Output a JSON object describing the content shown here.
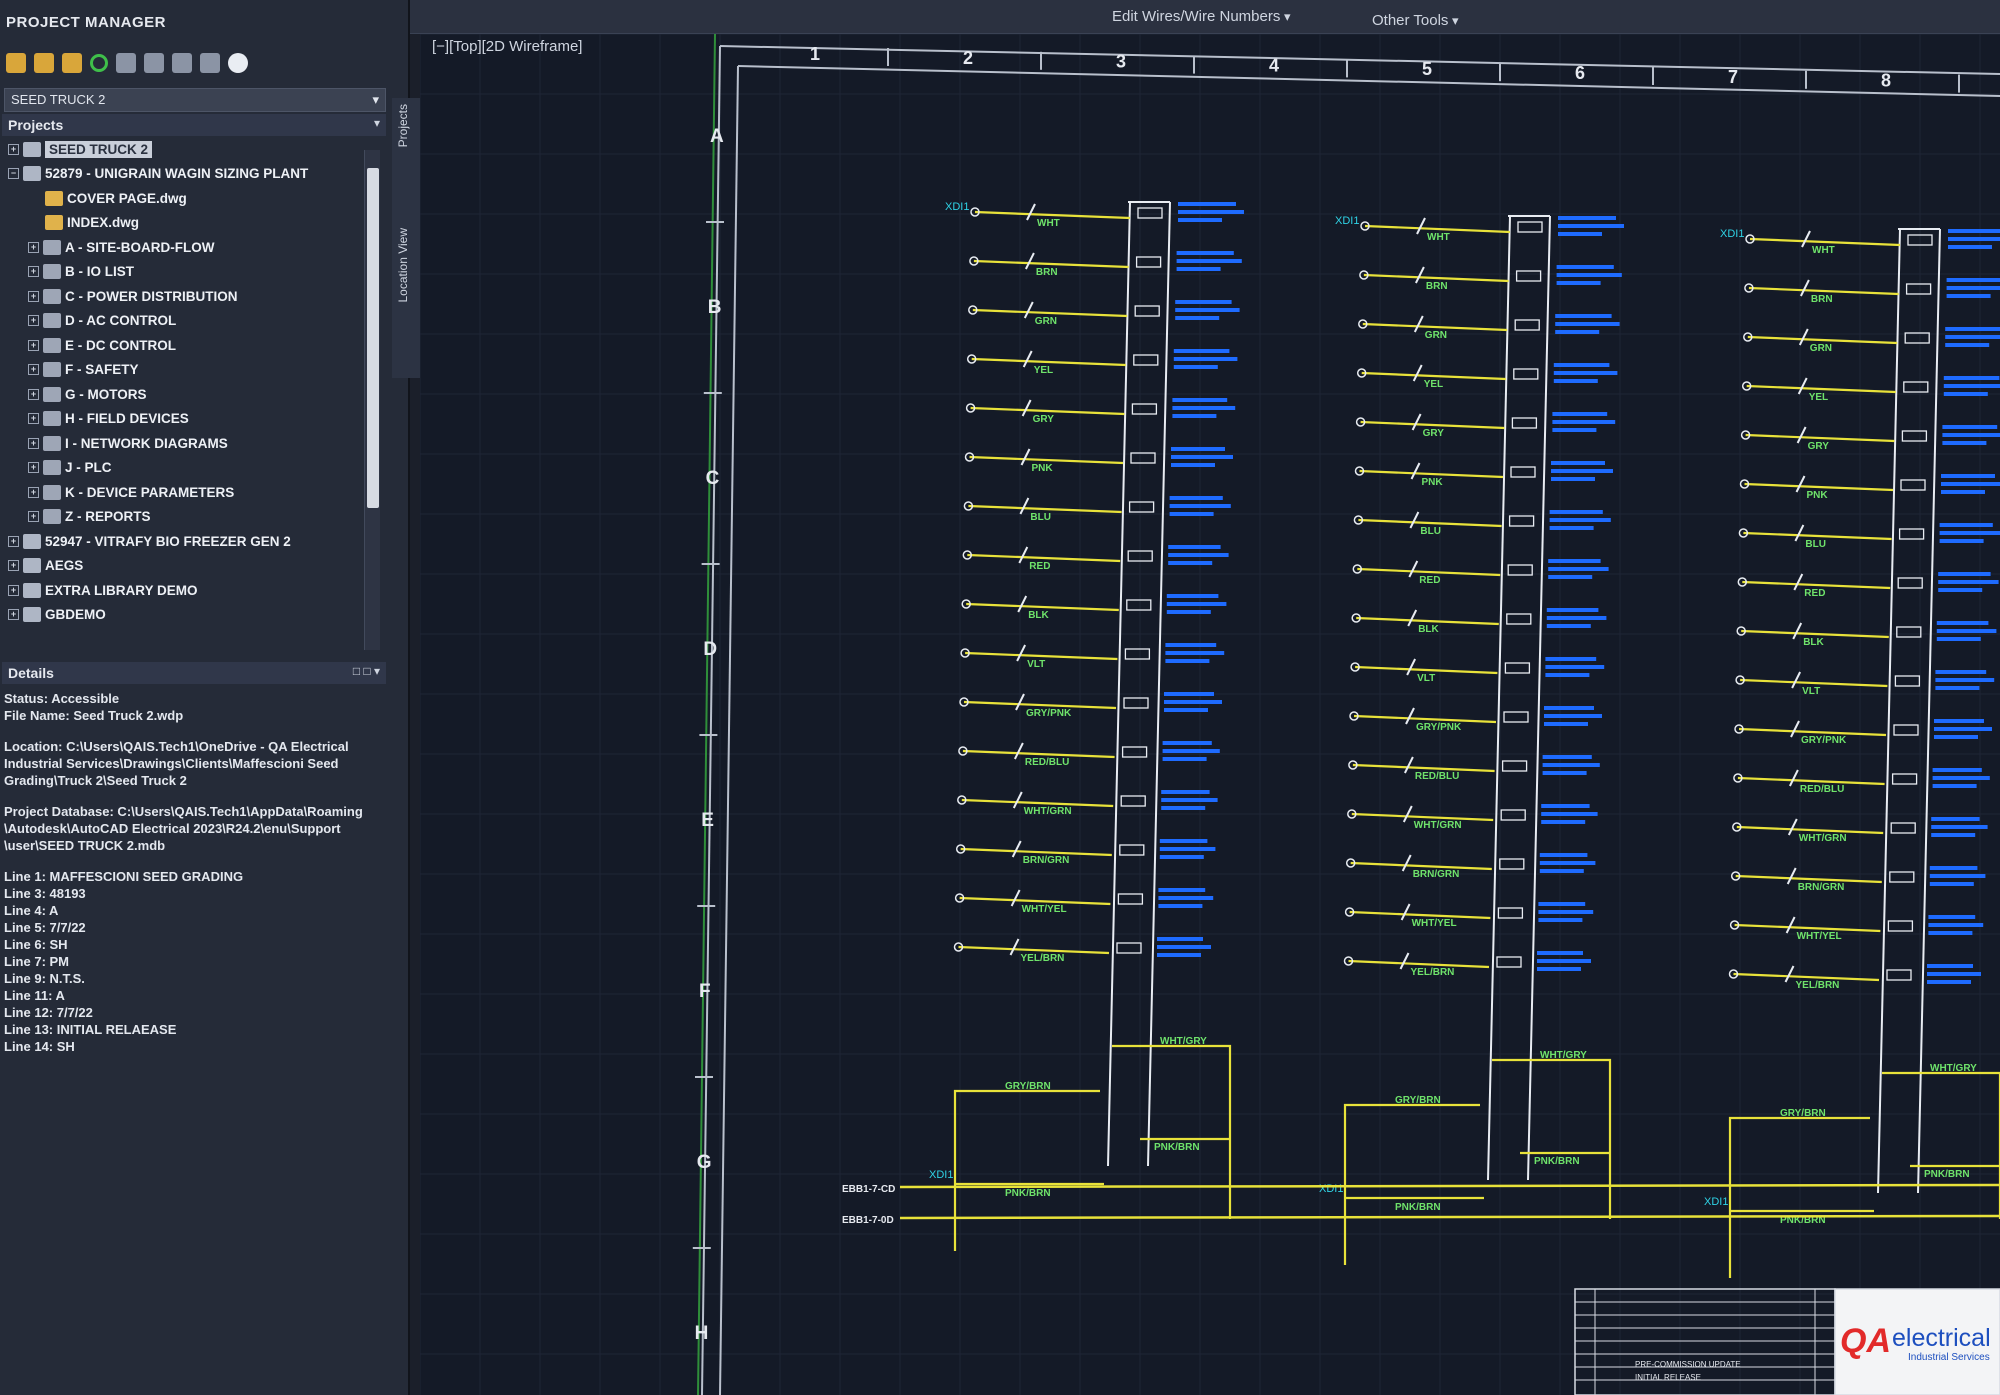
{
  "ribbon": {
    "tools": [
      {
        "label": "Edit Wires/Wire Numbers"
      },
      {
        "label": "Other Tools"
      }
    ]
  },
  "project_manager": {
    "title": "PROJECT MANAGER",
    "active_project": "SEED TRUCK 2",
    "projects_header": "Projects",
    "tree": [
      {
        "label": "SEED TRUCK 2",
        "icon": "project-icon",
        "level": 1,
        "selected": true
      },
      {
        "label": "52879 - UNIGRAIN WAGIN SIZING PLANT",
        "icon": "project-icon",
        "level": 1
      },
      {
        "label": "COVER PAGE.dwg",
        "icon": "drawing-icon",
        "level": 2
      },
      {
        "label": "INDEX.dwg",
        "icon": "drawing-icon",
        "level": 2
      },
      {
        "label": "A - SITE-BOARD-FLOW",
        "icon": "folder-icon",
        "level": 2
      },
      {
        "label": "B - IO LIST",
        "icon": "folder-icon",
        "level": 2
      },
      {
        "label": "C - POWER DISTRIBUTION",
        "icon": "folder-icon",
        "level": 2
      },
      {
        "label": "D - AC CONTROL",
        "icon": "folder-icon",
        "level": 2
      },
      {
        "label": "E - DC CONTROL",
        "icon": "folder-icon",
        "level": 2
      },
      {
        "label": "F - SAFETY",
        "icon": "folder-icon",
        "level": 2
      },
      {
        "label": "G - MOTORS",
        "icon": "folder-icon",
        "level": 2
      },
      {
        "label": "H - FIELD DEVICES",
        "icon": "folder-icon",
        "level": 2
      },
      {
        "label": "I - NETWORK DIAGRAMS",
        "icon": "folder-icon",
        "level": 2
      },
      {
        "label": "J - PLC",
        "icon": "folder-icon",
        "level": 2
      },
      {
        "label": "K - DEVICE PARAMETERS",
        "icon": "folder-icon",
        "level": 2
      },
      {
        "label": "Z - REPORTS",
        "icon": "folder-icon",
        "level": 2
      },
      {
        "label": "52947 - VITRAFY BIO FREEZER GEN 2",
        "icon": "project-icon",
        "level": 1
      },
      {
        "label": "AEGS",
        "icon": "project-icon",
        "level": 1
      },
      {
        "label": "EXTRA LIBRARY DEMO",
        "icon": "project-icon",
        "level": 1
      },
      {
        "label": "GBDEMO",
        "icon": "project-icon",
        "level": 1
      }
    ],
    "details_header": "Details",
    "details": [
      [
        "Status: Accessible",
        "File Name: Seed Truck 2.wdp"
      ],
      [
        "Location: C:\\Users\\QAIS.Tech1\\OneDrive - QA Electrical",
        "Industrial Services\\Drawings\\Clients\\Maffescioni  Seed",
        "Grading\\Truck 2\\Seed Truck 2"
      ],
      [
        "Project Database: C:\\Users\\QAIS.Tech1\\AppData\\Roaming",
        "\\Autodesk\\AutoCAD Electrical 2023\\R24.2\\enu\\Support",
        "\\user\\SEED TRUCK 2.mdb"
      ],
      [
        "Line 1: MAFFESCIONI SEED GRADING",
        "Line 3: 48193",
        "Line 4: A",
        "Line 5: 7/7/22",
        "Line 6: SH",
        "Line 7: PM",
        "Line 9: N.T.S.",
        "Line 11: A",
        "Line 12: 7/7/22",
        "Line 13: INITIAL RELAEASE",
        "Line 14: SH"
      ]
    ],
    "side_tabs": [
      "Projects",
      "Location View"
    ]
  },
  "drawing": {
    "viewport_label": "[−][Top][2D Wireframe]",
    "column_numbers": [
      "1",
      "2",
      "3",
      "4",
      "5",
      "6",
      "7",
      "8"
    ],
    "row_letters": [
      "A",
      "B",
      "C",
      "D",
      "E",
      "F",
      "G",
      "H"
    ],
    "module_headers": [
      "XDI1",
      "XDI1",
      "XDI1"
    ],
    "wire_colors": [
      "WHT",
      "BRN",
      "GRN",
      "YEL",
      "GRY",
      "PNK",
      "BLU",
      "RED",
      "BLK",
      "VLT",
      "GRY/PNK",
      "RED/BLU",
      "WHT/GRN",
      "BRN/GRN",
      "WHT/YEL",
      "YEL/BRN"
    ],
    "lower_wires": [
      "WHT/GRY",
      "GRY/BRN",
      "PNK/BRN",
      "PNK/BRN"
    ],
    "bus_labels": [
      "EBB1-7-CD",
      "EBB1-7-0D"
    ],
    "title_block": {
      "logo_qa": "QA",
      "logo_word": "electrical",
      "logo_sub": "Industrial Services",
      "revisions": [
        "PRE-COMMISSION UPDATE",
        "INITIAL RELEASE"
      ]
    }
  },
  "colors": {
    "wire_yellow": "#e8e23a",
    "device_green": "#6fe36b",
    "annotation_blue": "#1e6bff",
    "tag_cyan": "#2fd3e6",
    "logo_red": "#e22a2a",
    "logo_blue": "#1d4fbf"
  }
}
